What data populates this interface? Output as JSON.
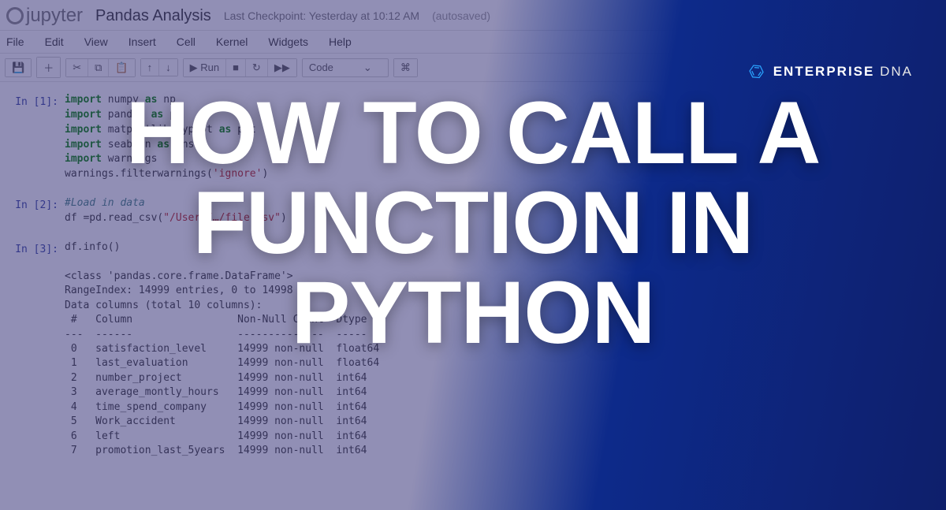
{
  "overlay": {
    "headline_line1": "HOW TO CALL A",
    "headline_line2": "FUNCTION IN",
    "headline_line3": "PYTHON",
    "brand_main": "ENTERPRISE",
    "brand_sub": "DNA"
  },
  "notebook": {
    "logo_text": "jupyter",
    "title": "Pandas Analysis",
    "checkpoint": "Last Checkpoint: Yesterday at 10:12 AM",
    "autosaved": "(autosaved)",
    "menu": [
      "File",
      "Edit",
      "View",
      "Insert",
      "Cell",
      "Kernel",
      "Widgets",
      "Help"
    ],
    "toolbar": {
      "save": "💾",
      "add": "＋",
      "cut": "✂",
      "copy": "⧉",
      "paste": "📋",
      "up": "↑",
      "down": "↓",
      "run": "▶ Run",
      "stop": "■",
      "restart": "↻",
      "ff": "▶▶",
      "cell_type": "Code",
      "cmd": "⌘"
    },
    "cells": {
      "c1_prompt": "In [1]:",
      "c1_line1a": "import",
      "c1_line1b": " numpy ",
      "c1_line1c": "as",
      "c1_line1d": " np",
      "c1_line2a": "import",
      "c1_line2b": " pandas ",
      "c1_line2c": "as",
      "c1_line2d": " pd",
      "c1_line3a": "import",
      "c1_line3b": " matplotlib.pyplot ",
      "c1_line3c": "as",
      "c1_line3d": " plt",
      "c1_line4a": "import",
      "c1_line4b": " seaborn ",
      "c1_line4c": "as",
      "c1_line4d": " sns",
      "c1_line5a": "import",
      "c1_line5b": " warnings",
      "c1_line6a": "warnings.filterwarnings(",
      "c1_line6b": "'ignore'",
      "c1_line6c": ")",
      "c2_prompt": "In [2]:",
      "c2_line1": "#Load in data",
      "c2_line2a": "df =pd.read_csv(",
      "c2_line2b": "\"/Users/…/file.csv\"",
      "c2_line2c": ")",
      "c3_prompt": "In [3]:",
      "c3_line1": "df.info()",
      "c3_out": "<class 'pandas.core.frame.DataFrame'>\nRangeIndex: 14999 entries, 0 to 14998\nData columns (total 10 columns):\n #   Column                 Non-Null Count  Dtype  \n---  ------                 --------------  -----  \n 0   satisfaction_level     14999 non-null  float64\n 1   last_evaluation        14999 non-null  float64\n 2   number_project         14999 non-null  int64  \n 3   average_montly_hours   14999 non-null  int64  \n 4   time_spend_company     14999 non-null  int64  \n 5   Work_accident          14999 non-null  int64  \n 6   left                   14999 non-null  int64  \n 7   promotion_last_5years  14999 non-null  int64  "
    }
  }
}
